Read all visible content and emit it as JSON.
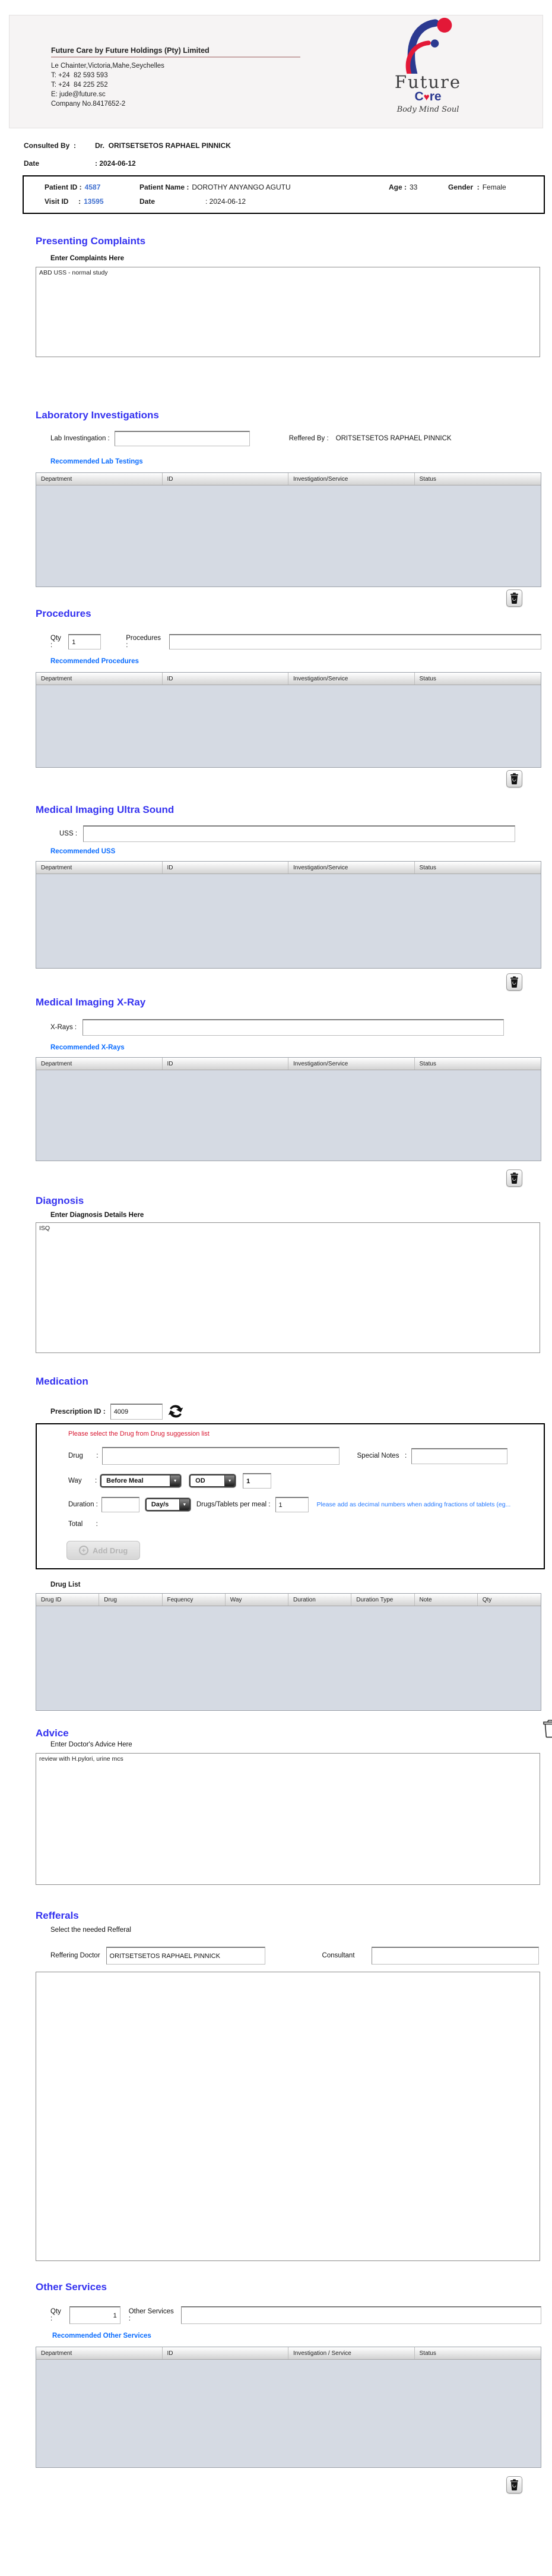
{
  "colors": {
    "section_title": "#3432f0",
    "link_blue": "#0a6cff",
    "id_blue": "#3f6fcf",
    "alert_red": "#d8152f",
    "helper_blue": "#2277ff",
    "table_body": "#d5dae3"
  },
  "clinic": {
    "name": "Future Care by Future Holdings (Pty) Limited",
    "address": "Le Chainter,Victoria,Mahe,Seychelles",
    "phone1": "T: +24  82 593 593",
    "phone2": "T: +24  84 225 252",
    "email": "E: jude@future.sc",
    "company_no": "Company No.8417652-2",
    "logo_word1": "Future",
    "logo_care_c": "C",
    "logo_care_heart": "♥",
    "logo_care_re": "re",
    "logo_tagline": "Body Mind Soul"
  },
  "consult": {
    "consulted_by_label": "Consulted By  :",
    "consulted_by_value": "Dr.  ORITSETSETOS RAPHAEL PINNICK",
    "date_label": "Date",
    "date_value": ": 2024-06-12"
  },
  "patient": {
    "patient_id_label": "Patient ID :",
    "patient_id": "4587",
    "name_label": "Patient Name :",
    "name": "DOROTHY ANYANGO AGUTU",
    "age_label": "Age :",
    "age": "33",
    "gender_label": "Gender  :",
    "gender": "Female",
    "visit_id_label": "Visit ID     :",
    "visit_id": "13595",
    "date_label": "Date",
    "date": ": 2024-06-12"
  },
  "complaints": {
    "title": "Presenting Complaints",
    "label": "Enter Complaints Here",
    "value": "ABD USS - normal study"
  },
  "laboratory": {
    "title": "Laboratory  Investigations",
    "lab_label": "Lab Investingation :",
    "lab_value": "",
    "reffered_label": "Reffered By :",
    "reffered_value": "ORITSETSETOS RAPHAEL PINNICK",
    "recommended": "Recommended Lab Testings",
    "headers": [
      "Department",
      "ID",
      "Investigation/Service",
      "Status"
    ]
  },
  "procedures": {
    "title": "Procedures",
    "qty_label": "Qty :",
    "qty_value": "1",
    "label": "Procedures :",
    "value": "",
    "recommended": "Recommended Procedures",
    "headers": [
      "Department",
      "ID",
      "Investigation/Service",
      "Status"
    ]
  },
  "uss": {
    "title": "Medical Imaging Ultra Sound",
    "label": "USS :",
    "value": "",
    "recommended": "Recommended USS",
    "headers": [
      "Department",
      "ID",
      "Investigation/Service",
      "Status"
    ]
  },
  "xray": {
    "title": "Medical Imaging X-Ray",
    "label": "X-Rays :",
    "value": "",
    "recommended": "Recommended X-Rays",
    "headers": [
      "Department",
      "ID",
      "Investigation/Service",
      "Status"
    ]
  },
  "diagnosis": {
    "title": "Diagnosis",
    "label": "Enter Diagnosis Details Here",
    "value": "ISQ"
  },
  "medication": {
    "title": "Medication",
    "prescription_label": "Prescription ID :",
    "prescription_id": "4009",
    "alert": "Please select the Drug from Drug suggession list",
    "drug_label": "Drug       :",
    "drug_value": "",
    "special_notes_label": "Special Notes   :",
    "special_notes_value": "",
    "way_label": "Way       :",
    "way_meal": "Before Meal",
    "way_freq": "OD",
    "way_qty": "1",
    "duration_label": "Duration :",
    "duration_value": "",
    "duration_type": "Day/s",
    "per_meal_label": "Drugs/Tablets per meal :",
    "per_meal_value": "1",
    "helper": "Please add as decimal numbers when adding fractions of tablets (eg...",
    "total_label": "Total       :",
    "total_value": "",
    "add_drug": "Add Drug"
  },
  "drug_list": {
    "label": "Drug List",
    "headers": [
      "Drug ID",
      "Drug",
      "Fequency",
      "Way",
      "Duration",
      "Duration Type",
      "Note",
      "Qty"
    ]
  },
  "advice": {
    "title": "Advice",
    "label": "Enter Doctor's Advice Here",
    "value": "review with H.pylori, urine mcs"
  },
  "refferals": {
    "title": "Refferals",
    "subtitle": "Select the needed Refferal",
    "doctor_label": "Reffering Doctor",
    "doctor_value": "ORITSETSETOS RAPHAEL PINNICK",
    "consultant_label": "Consultant",
    "consultant_value": ""
  },
  "other_services": {
    "title": "Other Services",
    "qty_label": "Qty :",
    "qty_value": "1",
    "label": "Other Services :",
    "value": "",
    "recommended": "Recommended Other Services",
    "headers": [
      "Department",
      "ID",
      "Investigation / Service",
      "Status"
    ]
  }
}
